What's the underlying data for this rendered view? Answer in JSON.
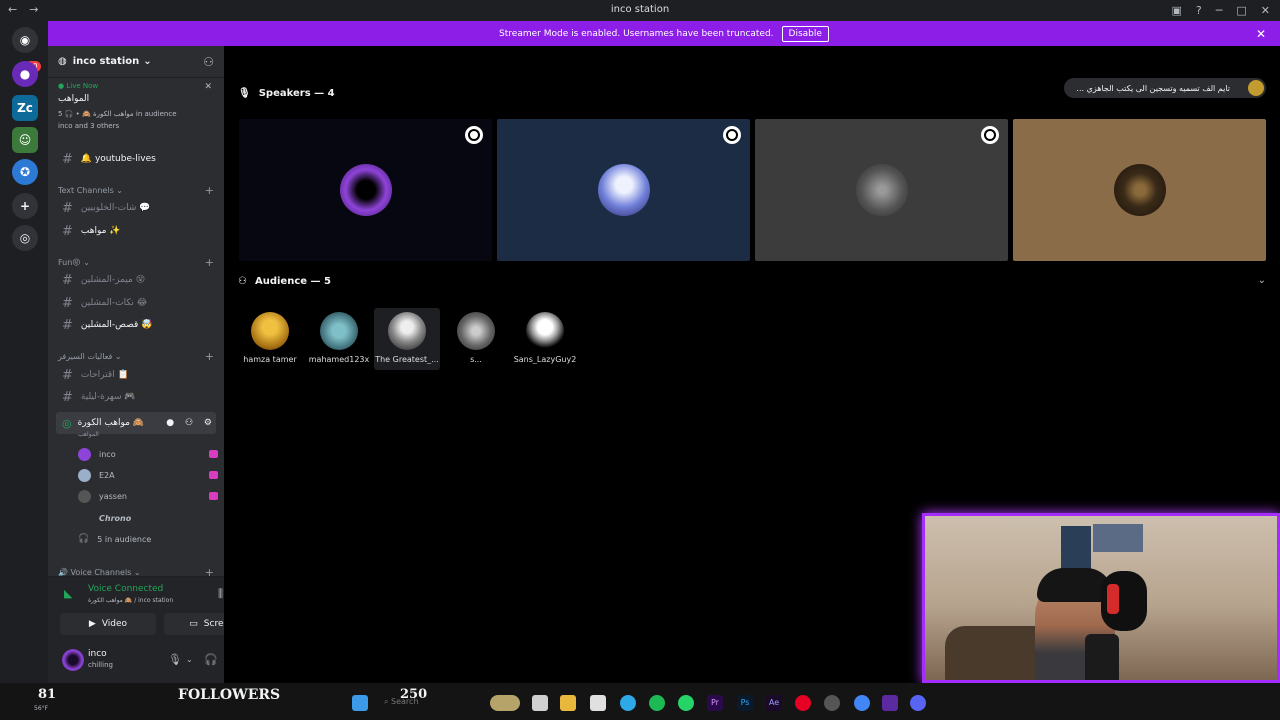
{
  "window": {
    "title": "inco station"
  },
  "banner": {
    "text": "Streamer Mode is enabled. Usernames have been truncated.",
    "button": "Disable"
  },
  "server": {
    "name": "inco station",
    "badge_count": "10"
  },
  "live": {
    "status": "Live Now",
    "title": "المواهب",
    "channel": "مواهب الكورة 🙈",
    "audience": "5 in audience",
    "others": "inco and 3 others"
  },
  "channels": {
    "youtube": "🔔 youtube-lives",
    "text_category": "Text Channels",
    "text_items": [
      "شات-الخلوبيين 💬",
      "مواهب ✨"
    ],
    "fun_category": "Fun😝",
    "fun_items": [
      "ميمز-المشلين 😵",
      "نكات-المشلين 😂",
      "قصص-المشلين 🤯"
    ],
    "server_category": "فعاليات السيرفر",
    "server_items": [
      "اقتراحات 📋",
      "سهرة-ليلية 🎮"
    ],
    "stage_name": "مواهب الكورة 🙈",
    "stage_sub": "المواهب",
    "members": [
      {
        "name": "inco",
        "color": "#8e44d8"
      },
      {
        "name": "E2A",
        "color": "#9ab0c8"
      },
      {
        "name": "yassen",
        "color": "#555"
      },
      {
        "name": "Chrono",
        "color": "#2b2d31"
      }
    ],
    "members_audience": "5 in audience",
    "voice_category": "🔊 Voice Channels"
  },
  "voice_panel": {
    "status": "Voice Connected",
    "location": "مواهب الكورة 🙈 / inco station",
    "video": "Video",
    "screen": "Screen"
  },
  "user": {
    "name": "inco",
    "status": "chilling"
  },
  "stage": {
    "speakers_header": "Speakers — 4",
    "audience_header": "Audience — 5",
    "topic": "... تايم الف تسميه وتسجين الى يكتب الجاهزي",
    "speakers": [
      {
        "bg": "#070712",
        "avatar": "#6a2ab8"
      },
      {
        "bg": "#1c2c44",
        "avatar": "#6f7fd8"
      },
      {
        "bg": "#3c3c3c",
        "avatar": "#7a7a7a"
      },
      {
        "bg": "#8a6c49",
        "avatar": "#3a2a18"
      }
    ],
    "audience": [
      {
        "name": "hamza tamer",
        "color": "#d8a528"
      },
      {
        "name": "mahamed123x",
        "color": "#4f7f88"
      },
      {
        "name": "The Greatest_...",
        "color": "#dcdcdc"
      },
      {
        "name": "s...",
        "color": "#9a9a9a"
      },
      {
        "name": "Sans_LazyGuy2",
        "color": "#f2f2f2"
      }
    ]
  },
  "taskbar": {
    "followers_count": "81",
    "followers_label": "FOLLOWERS",
    "goal": "250",
    "temp": "56°F",
    "search": "Search"
  }
}
